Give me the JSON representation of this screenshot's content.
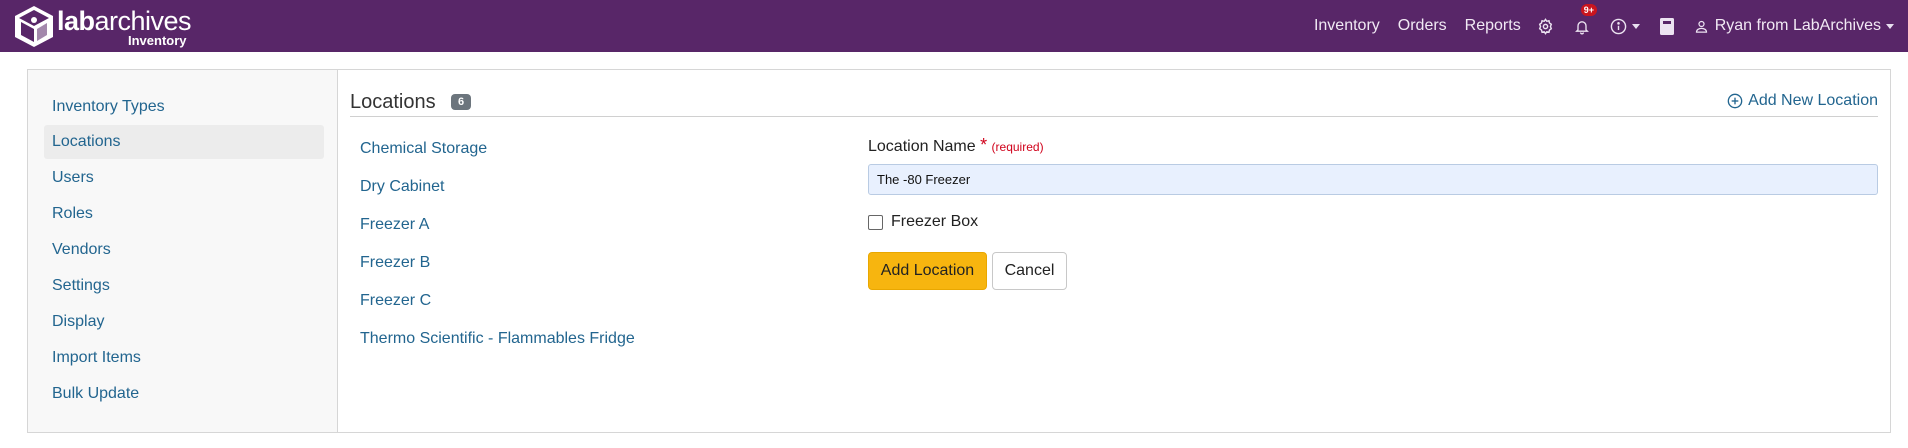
{
  "brand": {
    "name_bold": "lab",
    "name_rest": "archives",
    "subtitle": "Inventory",
    "logo_icon": "cube-logo-icon"
  },
  "nav": {
    "links": [
      "Inventory",
      "Orders",
      "Reports"
    ],
    "settings_icon": "gear-icon",
    "notifications_icon": "bell-icon",
    "notifications_badge": "9+",
    "help_icon": "info-circle-icon",
    "notebook_icon": "notebook-icon",
    "user_icon": "person-icon",
    "user_name": "Ryan from LabArchives"
  },
  "sidebar": {
    "items": [
      {
        "label": "Inventory Types",
        "active": false
      },
      {
        "label": "Locations",
        "active": true
      },
      {
        "label": "Users",
        "active": false
      },
      {
        "label": "Roles",
        "active": false
      },
      {
        "label": "Vendors",
        "active": false
      },
      {
        "label": "Settings",
        "active": false
      },
      {
        "label": "Display",
        "active": false
      },
      {
        "label": "Import Items",
        "active": false
      },
      {
        "label": "Bulk Update",
        "active": false
      }
    ]
  },
  "main": {
    "title": "Locations",
    "count": "6",
    "add_new_label": "Add New Location",
    "add_new_icon": "plus-circle-icon",
    "locations": [
      "Chemical Storage",
      "Dry Cabinet",
      "Freezer A",
      "Freezer B",
      "Freezer C",
      "Thermo Scientific - Flammables Fridge"
    ]
  },
  "form": {
    "name_label": "Location Name",
    "required_star": "*",
    "required_text": "(required)",
    "name_value": "The -80 Freezer",
    "checkbox_label": "Freezer Box",
    "checkbox_checked": false,
    "add_button": "Add Location",
    "cancel_button": "Cancel"
  },
  "colors": {
    "navbar": "#582668",
    "link": "#22658f",
    "primary_button": "#f7b50f",
    "badge": "#6c757d",
    "notification_badge": "#c9151e"
  }
}
